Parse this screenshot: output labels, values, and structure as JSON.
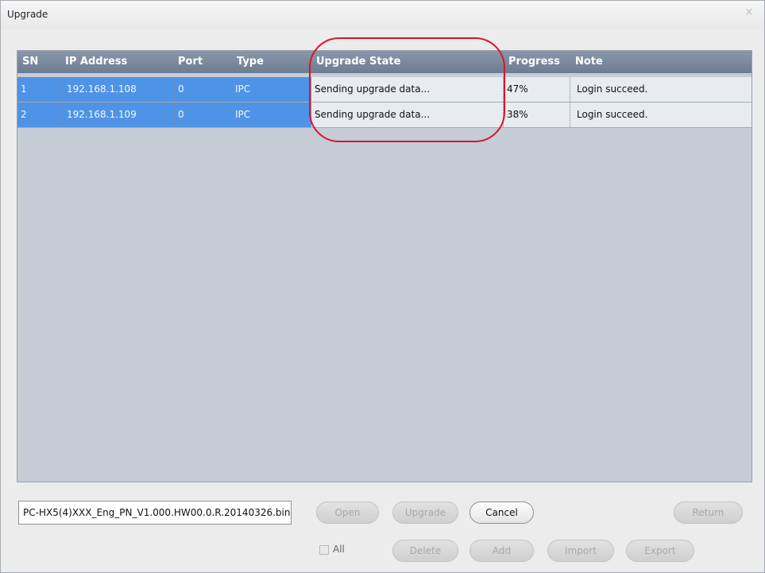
{
  "window": {
    "title": "Upgrade",
    "close_glyph": "×"
  },
  "table": {
    "columns": {
      "sn": "SN",
      "ip": "IP Address",
      "port": "Port",
      "type": "Type",
      "state": "Upgrade State",
      "progress": "Progress",
      "note": "Note"
    },
    "rows": [
      {
        "sn": "1",
        "ip": "192.168.1.108",
        "port": "0",
        "type": "IPC",
        "state": "Sending upgrade data...",
        "progress": "47%",
        "note": "Login succeed."
      },
      {
        "sn": "2",
        "ip": "192.168.1.109",
        "port": "0",
        "type": "IPC",
        "state": "Sending upgrade data...",
        "progress": "38%",
        "note": "Login succeed."
      }
    ]
  },
  "file_path": "PC-HX5(4)XXX_Eng_PN_V1.000.HW00.0.R.20140326.bin",
  "buttons": {
    "open": "Open",
    "upgrade": "Upgrade",
    "cancel": "Cancel",
    "return": "Return",
    "delete": "Delete",
    "add": "Add",
    "import": "Import",
    "export": "Export"
  },
  "all_checkbox": {
    "label": "All",
    "checked": false
  },
  "colors": {
    "selection": "#4f93e6",
    "header": "#6d7c91",
    "highlight_ring": "#d9142a"
  }
}
